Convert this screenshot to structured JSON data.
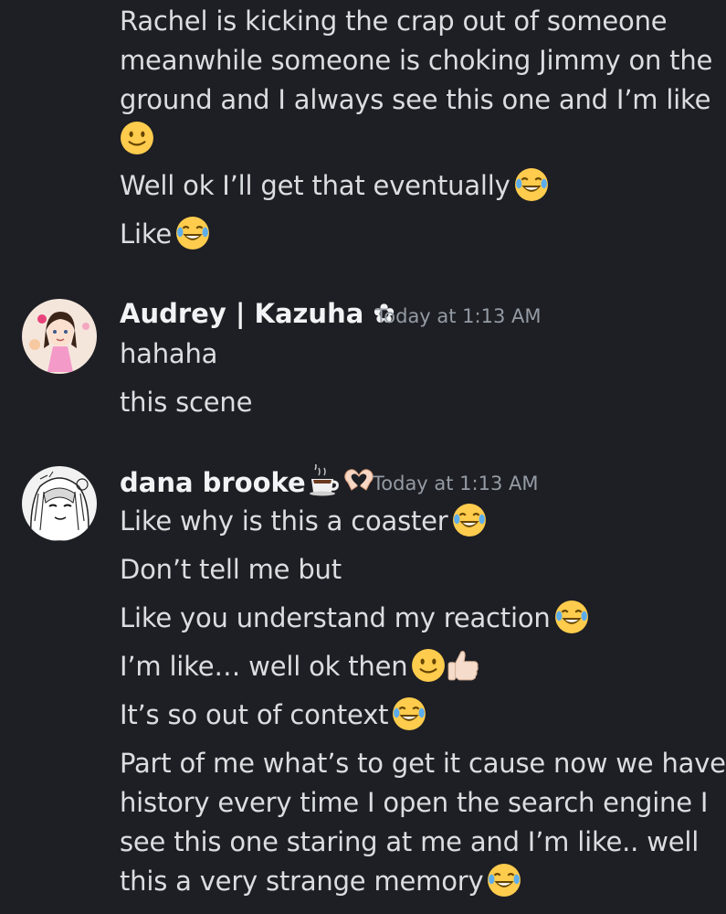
{
  "first_message": {
    "lines": [
      "Rachel is kicking the crap out of someone",
      "meanwhile someone is choking Jimmy on the",
      "ground and I always see this one and I’m like"
    ],
    "line_emoji_only": "slightly-smiling-face",
    "line4": "Well ok I’ll get that eventually",
    "line5": "Like"
  },
  "audrey_message": {
    "author": "Audrey | Kazuha ✿",
    "timestamp": "Today at 1:13 AM",
    "lines": [
      "hahaha",
      "this scene"
    ],
    "avatar_icon": "anime-girl-avatar"
  },
  "dana_message": {
    "author": "dana brooke",
    "author_emojis": [
      "hot-beverage",
      "heart-hands"
    ],
    "timestamp": "Today at 1:13 AM",
    "line1": "Like why is this a coaster",
    "line2": "Don’t tell me but",
    "line3": "Like you understand my reaction",
    "line4": "I’m like… well ok then",
    "line5": "It’s so out of context",
    "paragraph": [
      "Part of me what’s to get it cause now we have",
      "history every time I open the search engine I",
      "see this one staring at me and I’m like.. well",
      "this a very strange memory"
    ],
    "avatar_icon": "sketch-girl-avatar"
  },
  "colors": {
    "background": "#1e1f24",
    "text": "#dbdee1",
    "author": "#f2f3f5",
    "timestamp": "#949ba4"
  }
}
